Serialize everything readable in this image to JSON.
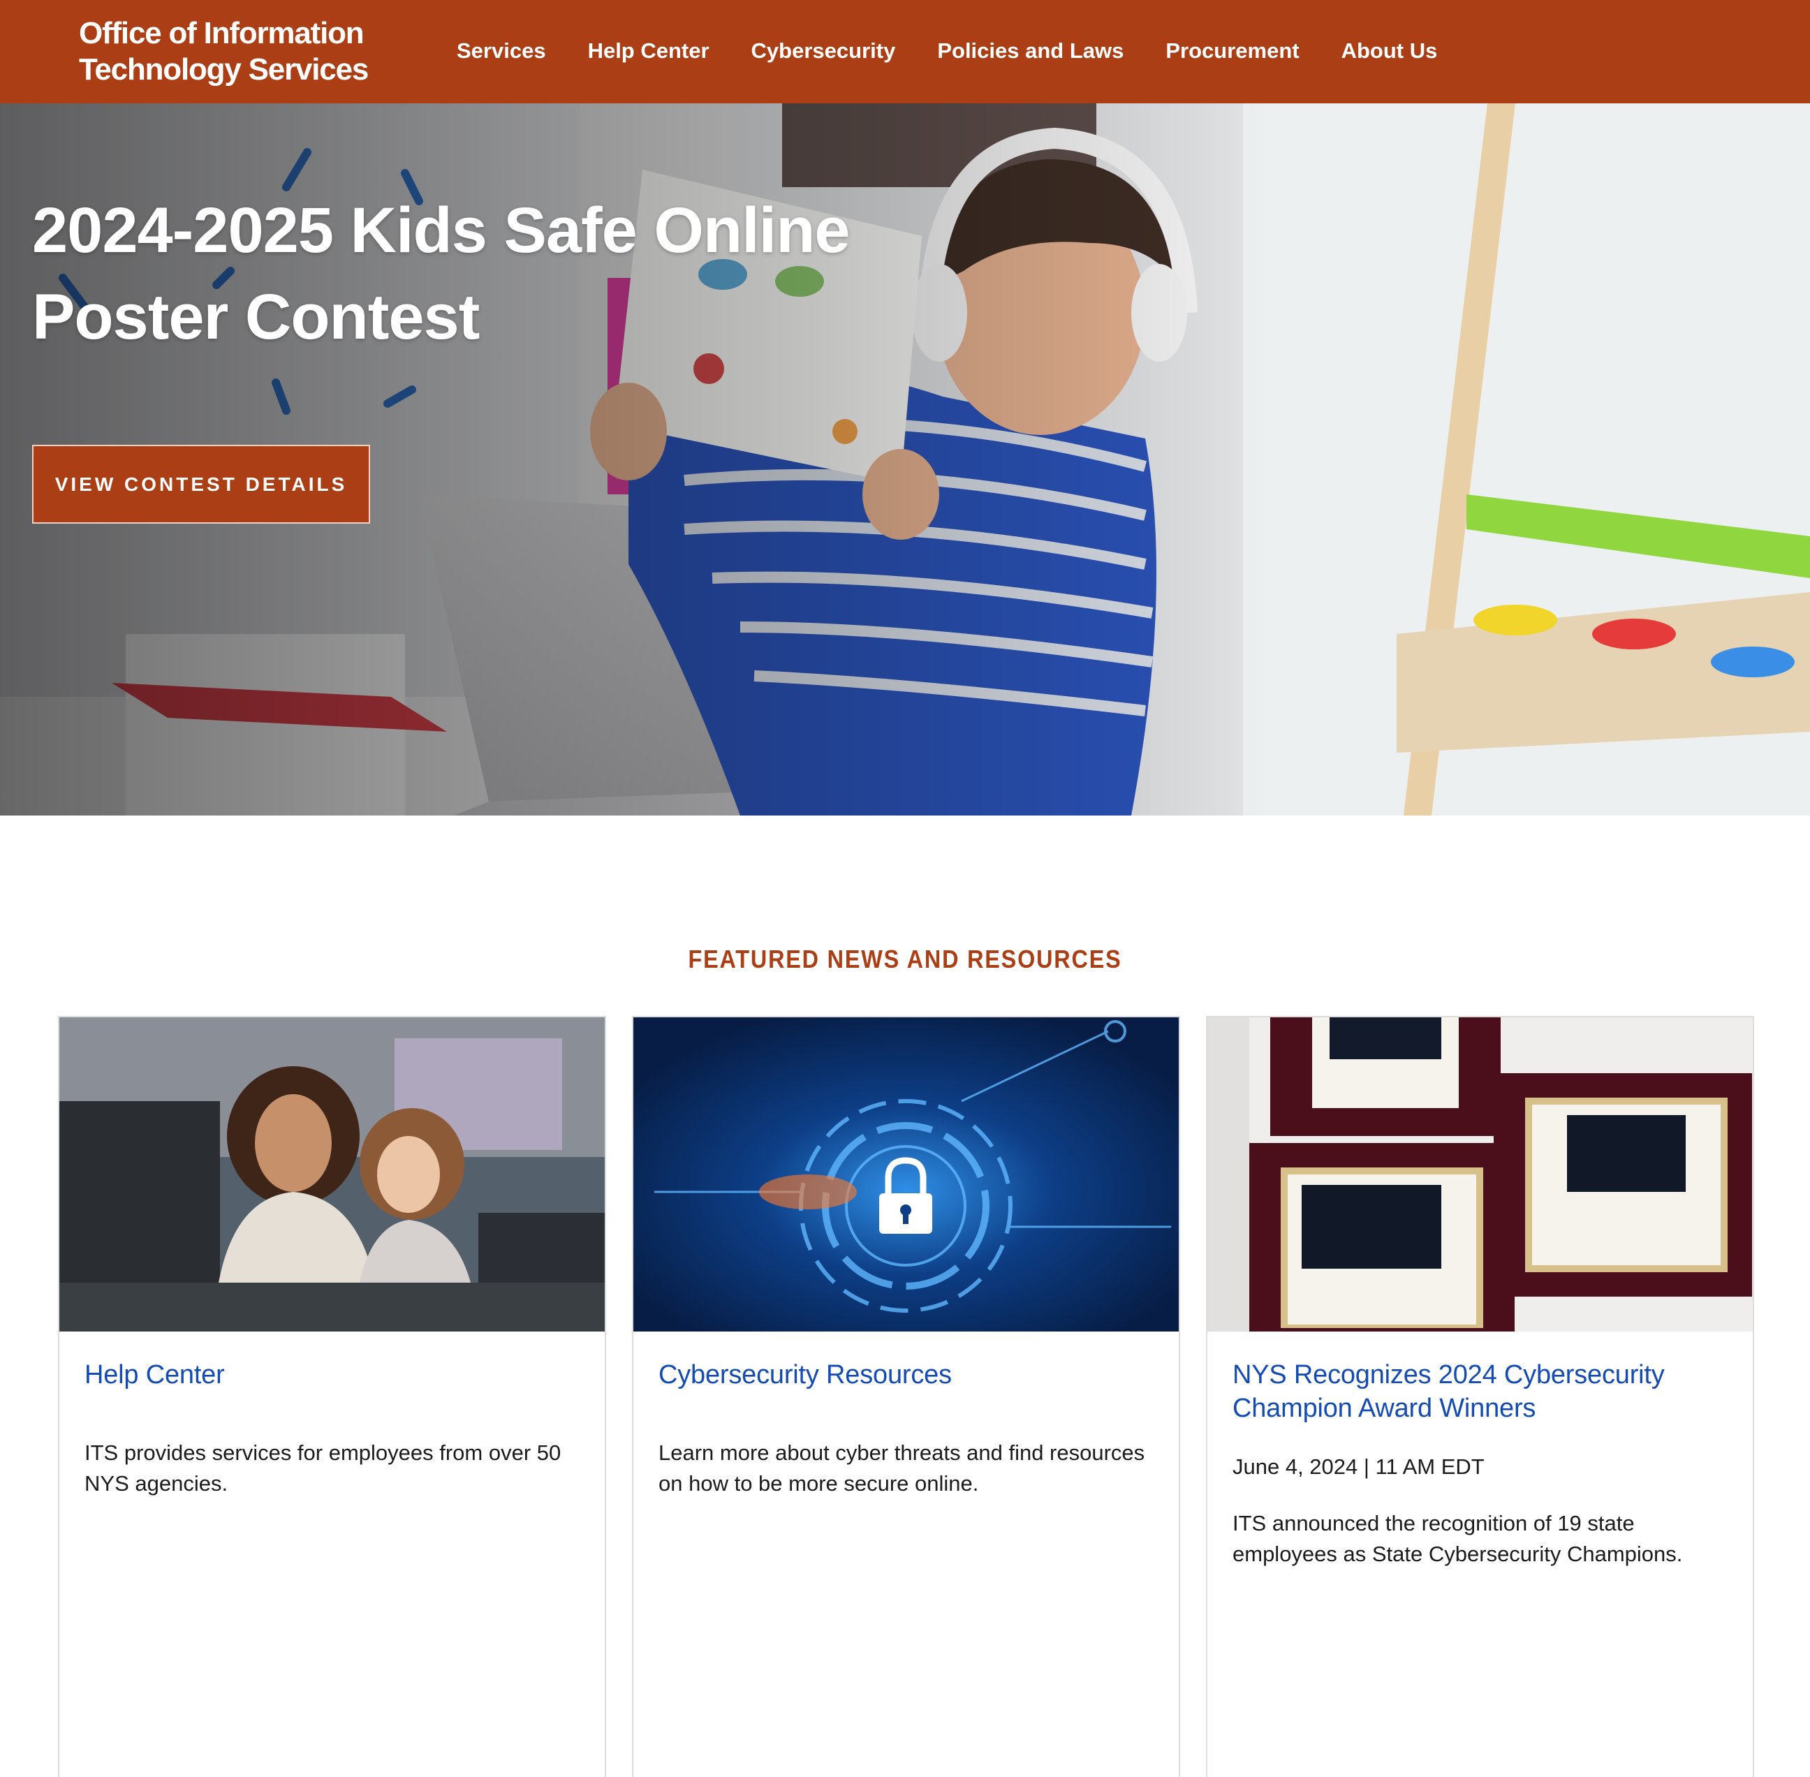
{
  "header": {
    "logo_line1": "Office of Information",
    "logo_line2": "Technology Services",
    "nav": [
      {
        "label": "Services"
      },
      {
        "label": "Help Center"
      },
      {
        "label": "Cybersecurity"
      },
      {
        "label": "Policies and Laws"
      },
      {
        "label": "Procurement"
      },
      {
        "label": "About Us"
      }
    ],
    "brand_color": "#ac3e16"
  },
  "hero": {
    "title": "2024-2025 Kids Safe Online Poster Contest",
    "cta_label": "VIEW CONTEST DETAILS"
  },
  "featured": {
    "heading": "FEATURED NEWS AND RESOURCES",
    "cards": [
      {
        "title": "Help Center",
        "text": "ITS provides services for employees from over 50 NYS agencies."
      },
      {
        "title": "Cybersecurity Resources",
        "text": "Learn more about cyber threats and find resources on how to be more secure online."
      },
      {
        "title": "NYS Recognizes 2024 Cybersecurity Champion Award Winners",
        "date": "June 4, 2024 | 11 AM EDT",
        "text": "ITS announced the recognition of 19 state employees as State Cybersecurity Champions."
      }
    ],
    "link_color": "#154bb5"
  }
}
